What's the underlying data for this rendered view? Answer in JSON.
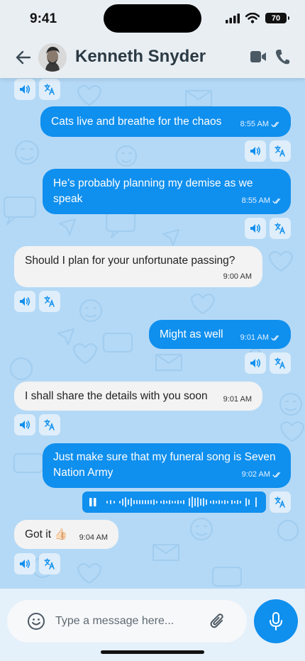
{
  "status": {
    "time": "9:41",
    "battery": "70"
  },
  "header": {
    "contact_name": "Kenneth Snyder"
  },
  "messages": [
    {
      "text": "Cats live and breathe for the chaos",
      "time": "8:55 AM"
    },
    {
      "text": "He’s probably planning my demise as we speak",
      "time": "8:55 AM"
    },
    {
      "text": "Should I plan for your unfortunate passing?",
      "time": "9:00 AM"
    },
    {
      "text": "Might as well",
      "time": "9:01 AM"
    },
    {
      "text": "I shall share the details with you soon",
      "time": "9:01 AM"
    },
    {
      "text": "Just make sure that my funeral song is Seven Nation Army",
      "time": "9:02 AM"
    },
    {
      "text": "Got it 👍🏻",
      "time": "9:04 AM"
    }
  ],
  "composer": {
    "placeholder": "Type a message here..."
  },
  "colors": {
    "outgoing": "#0f8fee",
    "incoming": "#f3f3f3",
    "header": "#e9eef3",
    "background": "#b4d9f6"
  }
}
